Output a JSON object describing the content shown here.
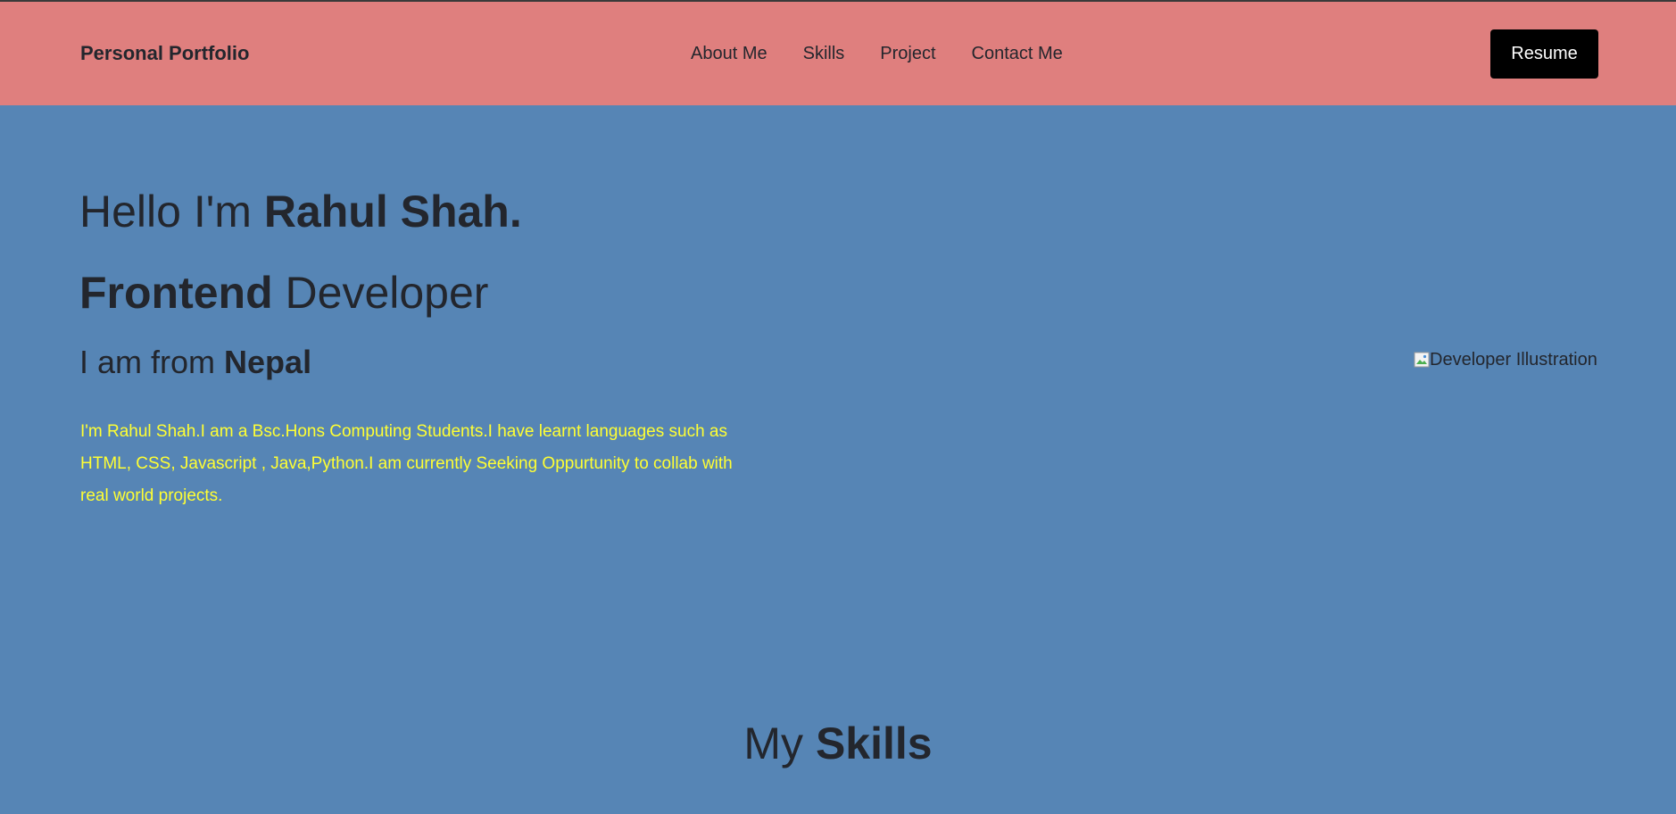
{
  "navbar": {
    "brand": "Personal Portfolio",
    "links": [
      "About Me",
      "Skills",
      "Project",
      "Contact Me"
    ],
    "resume_label": "Resume"
  },
  "hero": {
    "greeting_prefix": "Hello I'm ",
    "name": "Rahul Shah.",
    "role_bold": "Frontend",
    "role_rest": " Developer",
    "from_prefix": "I am from ",
    "country": "Nepal",
    "bio": "I'm Rahul Shah.I am a Bsc.Hons Computing Students.I have learnt languages such as HTML, CSS, Javascript , Java,Python.I am currently Seeking Oppurtunity to collab with real world projects.",
    "image_alt": "Developer Illustration"
  },
  "skills": {
    "heading_prefix": "My ",
    "heading_bold": "Skills"
  },
  "colors": {
    "navbar_bg": "#df7f7e",
    "page_bg": "#5685b5",
    "bio_text": "#ffff33",
    "button_bg": "#000000"
  }
}
